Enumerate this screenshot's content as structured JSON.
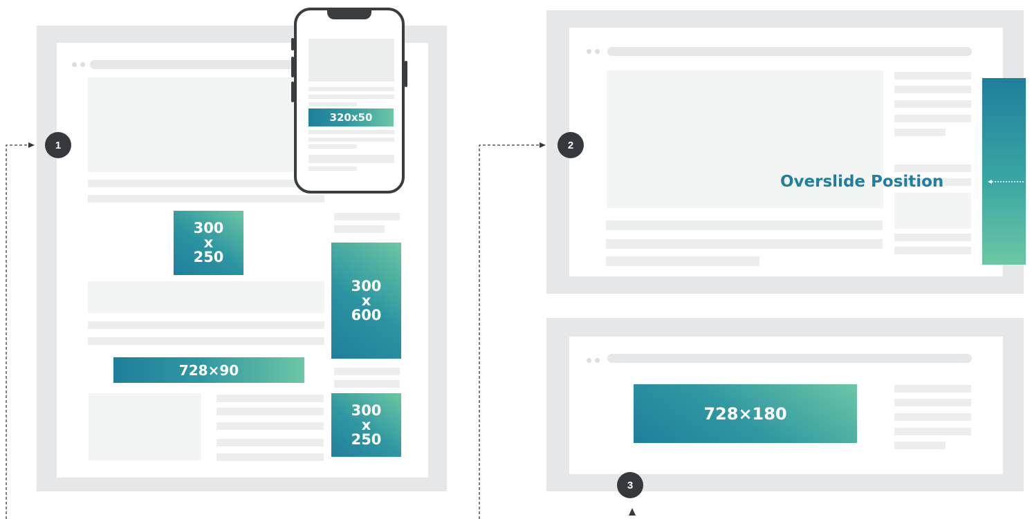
{
  "badges": {
    "one": "1",
    "two": "2",
    "three": "3"
  },
  "ads": {
    "mobile_banner": "320x50",
    "inline_rect": "300\nx\n250",
    "sidebar_skyscraper": "300\nx\n600",
    "leaderboard": "728×90",
    "sidebar_rect": "300\nx\n250",
    "billboard": "728×180"
  },
  "overslide_label": "Overslide Position",
  "colors": {
    "gradient_start": "#1f7f9c",
    "gradient_end": "#6cc7a4",
    "badge": "#35383c",
    "frame": "#e6e7e9"
  },
  "icons": {
    "arrow": "arrow-right-icon",
    "arrow_up": "arrow-up-icon",
    "arrow_left": "arrow-left-icon"
  }
}
